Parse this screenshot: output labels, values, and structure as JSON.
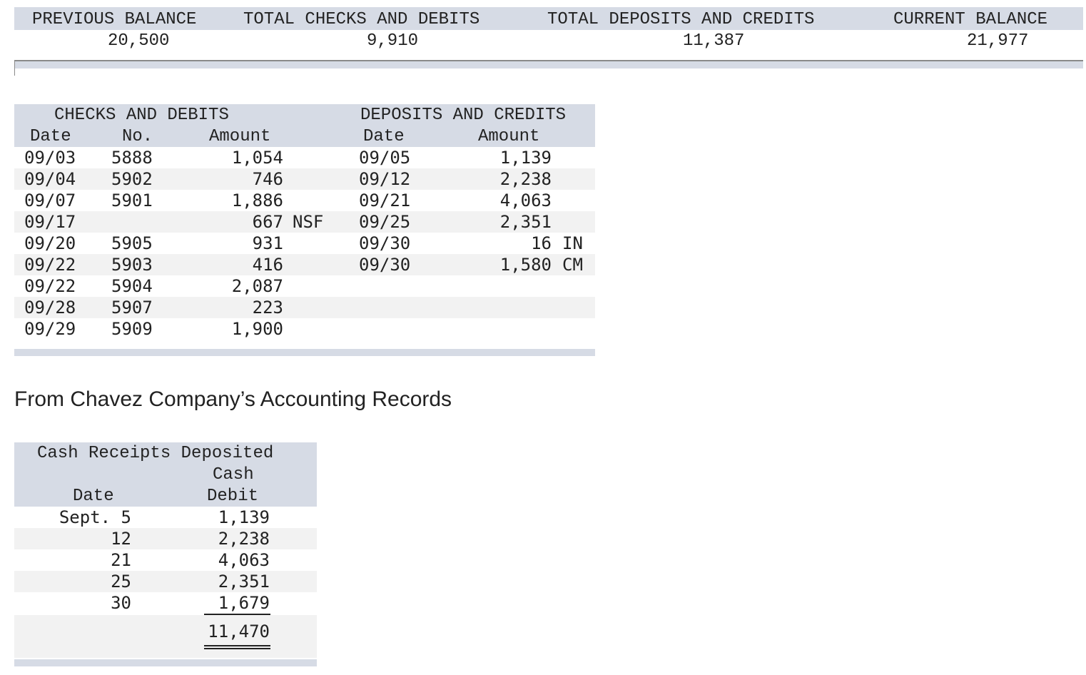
{
  "summary": {
    "previous_balance_label": "PREVIOUS BALANCE",
    "previous_balance": "20,500",
    "total_checks_label": "TOTAL CHECKS AND DEBITS",
    "total_checks": "9,910",
    "total_deposits_label": "TOTAL DEPOSITS AND CREDITS",
    "total_deposits": "11,387",
    "current_balance_label": "CURRENT BALANCE",
    "current_balance": "21,977"
  },
  "statement": {
    "checks_title": "CHECKS AND DEBITS",
    "deposits_title": "DEPOSITS AND CREDITS",
    "checks_columns": [
      "Date",
      "No.",
      "Amount"
    ],
    "deposits_columns": [
      "Date",
      "Amount"
    ],
    "checks": [
      {
        "date": "09/03",
        "no": "5888",
        "amount": "1,054",
        "code": ""
      },
      {
        "date": "09/04",
        "no": "5902",
        "amount": "746",
        "code": ""
      },
      {
        "date": "09/07",
        "no": "5901",
        "amount": "1,886",
        "code": ""
      },
      {
        "date": "09/17",
        "no": "",
        "amount": "667",
        "code": "NSF"
      },
      {
        "date": "09/20",
        "no": "5905",
        "amount": "931",
        "code": ""
      },
      {
        "date": "09/22",
        "no": "5903",
        "amount": "416",
        "code": ""
      },
      {
        "date": "09/22",
        "no": "5904",
        "amount": "2,087",
        "code": ""
      },
      {
        "date": "09/28",
        "no": "5907",
        "amount": "223",
        "code": ""
      },
      {
        "date": "09/29",
        "no": "5909",
        "amount": "1,900",
        "code": ""
      }
    ],
    "deposits": [
      {
        "date": "09/05",
        "amount": "1,139",
        "code": ""
      },
      {
        "date": "09/12",
        "amount": "2,238",
        "code": ""
      },
      {
        "date": "09/21",
        "amount": "4,063",
        "code": ""
      },
      {
        "date": "09/25",
        "amount": "2,351",
        "code": ""
      },
      {
        "date": "09/30",
        "amount": "16",
        "code": "IN"
      },
      {
        "date": "09/30",
        "amount": "1,580",
        "code": "CM"
      }
    ]
  },
  "section_title": "From Chavez Company’s Accounting Records",
  "cash_receipts": {
    "title": "Cash Receipts Deposited",
    "col_date": "Date",
    "col_amount_line1": "Cash",
    "col_amount_line2": "Debit",
    "rows": [
      {
        "date": "Sept. 5",
        "amount": "1,139"
      },
      {
        "date": "12",
        "amount": "2,238"
      },
      {
        "date": "21",
        "amount": "4,063"
      },
      {
        "date": "25",
        "amount": "2,351"
      },
      {
        "date": "30",
        "amount": "1,679"
      }
    ],
    "total": "11,470"
  },
  "colors": {
    "header_band": "#d6dbe5",
    "stripe": "#f2f2f2",
    "text": "#222222"
  }
}
